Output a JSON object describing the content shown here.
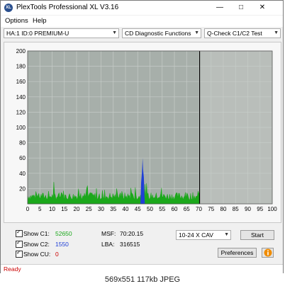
{
  "window": {
    "title": "PlexTools Professional XL V3.16",
    "minimize": "—",
    "maximize": "□",
    "close": "✕",
    "icon_text": "XL"
  },
  "menu": {
    "options": "Options",
    "help": "Help"
  },
  "toolbar": {
    "drive": "HA:1 ID:0  PREMIUM-U",
    "function": "CD Diagnostic Functions",
    "test": "Q-Check C1/C2 Test"
  },
  "chart_data": {
    "type": "bar",
    "xlim": [
      0,
      100
    ],
    "ylim": [
      0,
      200
    ],
    "x_ticks": [
      "0",
      "5",
      "10",
      "15",
      "20",
      "25",
      "30",
      "35",
      "40",
      "45",
      "50",
      "55",
      "60",
      "65",
      "70",
      "75",
      "80",
      "85",
      "90",
      "95",
      "100"
    ],
    "y_ticks": [
      "20",
      "40",
      "60",
      "80",
      "100",
      "120",
      "140",
      "160",
      "180",
      "200"
    ],
    "disc_end_x": 70.3,
    "grid": true,
    "series": [
      {
        "color": "#1ba81b",
        "approx_level": 8,
        "approx_peak": 24,
        "approx_range": [
          0,
          70.3
        ]
      },
      {
        "color": "#1f3fd6",
        "approx_spike_x": 47,
        "approx_spike_y": 60
      }
    ]
  },
  "stats": {
    "c1_label": "Show C1:",
    "c1_value": "52650",
    "c2_label": "Show C2:",
    "c2_value": "1550",
    "cu_label": "Show CU:",
    "cu_value": "0",
    "msf_label": "MSF:",
    "msf_value": "70:20.15",
    "lba_label": "LBA:",
    "lba_value": "316515"
  },
  "controls": {
    "speed": "10-24 X CAV",
    "start": "Start",
    "preferences": "Preferences",
    "info_icon": "info-icon"
  },
  "status": {
    "text": "Ready"
  },
  "caption": {
    "text": "569x551 117kb JPEG"
  },
  "colors": {
    "c1": "#1ba81b",
    "c2": "#1f3fd6",
    "status": "#cc0000",
    "c2_value": "#1f3fd6",
    "cu_value": "#cc0000"
  }
}
